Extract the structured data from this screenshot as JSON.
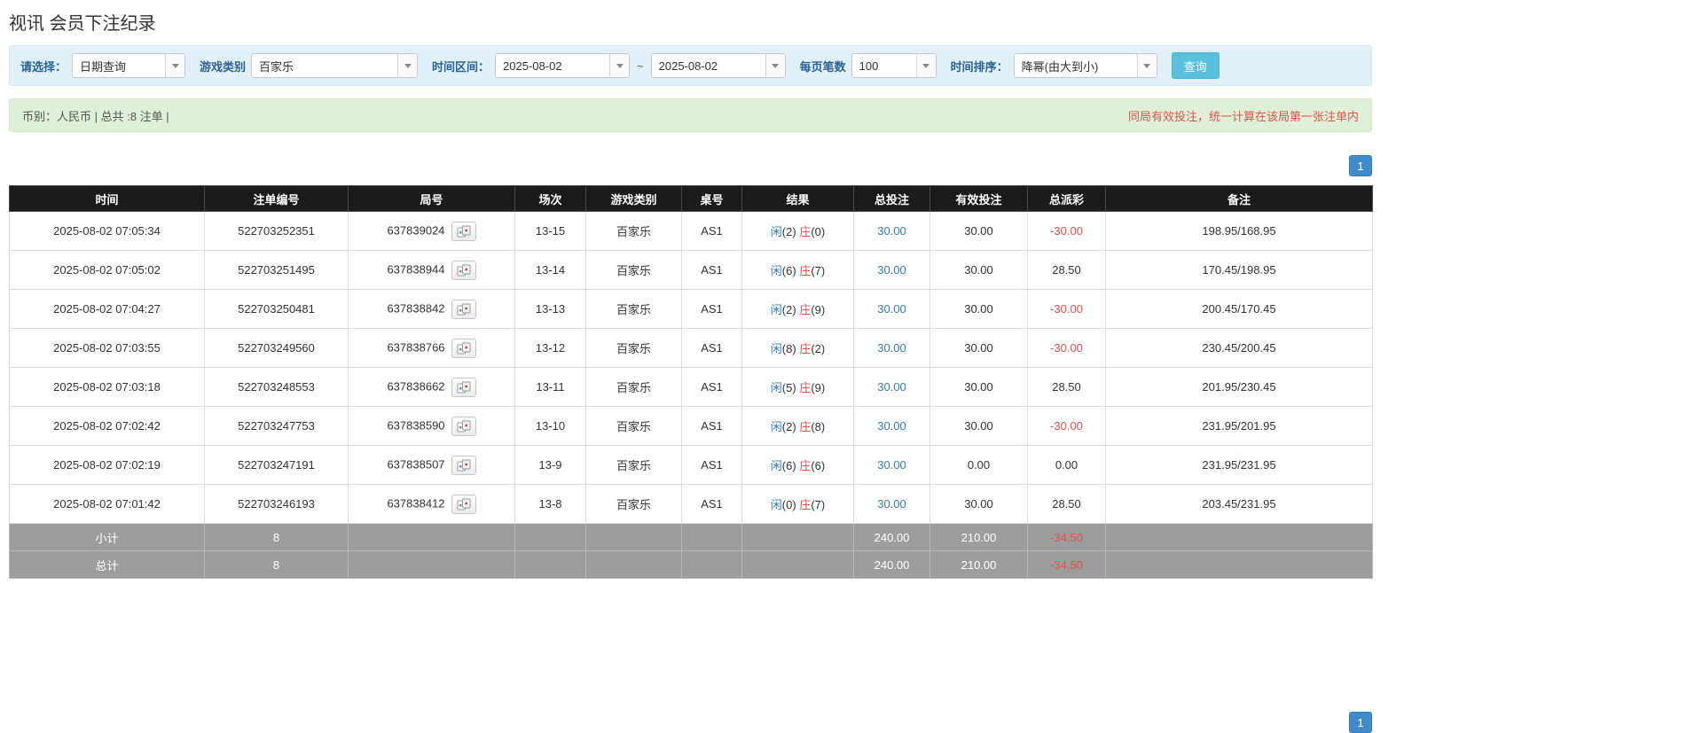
{
  "page": {
    "title": "视讯 会员下注纪录"
  },
  "filters": {
    "select_label": "请选择：",
    "select_value": "日期查询",
    "game_label": "游戏类别",
    "game_value": "百家乐",
    "range_label": "时间区间：",
    "date_from": "2025-08-02",
    "tilde": "~",
    "date_to": "2025-08-02",
    "per_page_label": "每页笔数",
    "per_page_value": "100",
    "sort_label": "时间排序：",
    "sort_value": "降幂(由大到小)",
    "query_button": "查询"
  },
  "summary": {
    "left": "币别：人民币 | 总共 :8 注单 |",
    "right": "同局有效投注，统一计算在该局第一张注单内"
  },
  "pagination": {
    "page": "1"
  },
  "icons": {
    "round_detail": "cards-preview-icon",
    "dropdown": "chevron-down-icon"
  },
  "table": {
    "headers": [
      "时间",
      "注单编号",
      "局号",
      "场次",
      "游戏类别",
      "桌号",
      "结果",
      "总投注",
      "有效投注",
      "总派彩",
      "备注"
    ],
    "rows": [
      {
        "time": "2025-08-02 07:05:34",
        "bet_id": "522703252351",
        "round": "637839024",
        "session": "13-15",
        "game": "百家乐",
        "table_no": "AS1",
        "player": "闲",
        "player_n": "(2)",
        "banker": "庄",
        "banker_n": "(0)",
        "total_bet": "30.00",
        "valid_bet": "30.00",
        "payout": "-30.00",
        "remark": "198.95/168.95"
      },
      {
        "time": "2025-08-02 07:05:02",
        "bet_id": "522703251495",
        "round": "637838944",
        "session": "13-14",
        "game": "百家乐",
        "table_no": "AS1",
        "player": "闲",
        "player_n": "(6)",
        "banker": "庄",
        "banker_n": "(7)",
        "total_bet": "30.00",
        "valid_bet": "30.00",
        "payout": "28.50",
        "remark": "170.45/198.95"
      },
      {
        "time": "2025-08-02 07:04:27",
        "bet_id": "522703250481",
        "round": "637838842",
        "session": "13-13",
        "game": "百家乐",
        "table_no": "AS1",
        "player": "闲",
        "player_n": "(2)",
        "banker": "庄",
        "banker_n": "(9)",
        "total_bet": "30.00",
        "valid_bet": "30.00",
        "payout": "-30.00",
        "remark": "200.45/170.45"
      },
      {
        "time": "2025-08-02 07:03:55",
        "bet_id": "522703249560",
        "round": "637838766",
        "session": "13-12",
        "game": "百家乐",
        "table_no": "AS1",
        "player": "闲",
        "player_n": "(8)",
        "banker": "庄",
        "banker_n": "(2)",
        "total_bet": "30.00",
        "valid_bet": "30.00",
        "payout": "-30.00",
        "remark": "230.45/200.45"
      },
      {
        "time": "2025-08-02 07:03:18",
        "bet_id": "522703248553",
        "round": "637838662",
        "session": "13-11",
        "game": "百家乐",
        "table_no": "AS1",
        "player": "闲",
        "player_n": "(5)",
        "banker": "庄",
        "banker_n": "(9)",
        "total_bet": "30.00",
        "valid_bet": "30.00",
        "payout": "28.50",
        "remark": "201.95/230.45"
      },
      {
        "time": "2025-08-02 07:02:42",
        "bet_id": "522703247753",
        "round": "637838590",
        "session": "13-10",
        "game": "百家乐",
        "table_no": "AS1",
        "player": "闲",
        "player_n": "(2)",
        "banker": "庄",
        "banker_n": "(8)",
        "total_bet": "30.00",
        "valid_bet": "30.00",
        "payout": "-30.00",
        "remark": "231.95/201.95"
      },
      {
        "time": "2025-08-02 07:02:19",
        "bet_id": "522703247191",
        "round": "637838507",
        "session": "13-9",
        "game": "百家乐",
        "table_no": "AS1",
        "player": "闲",
        "player_n": "(6)",
        "banker": "庄",
        "banker_n": "(6)",
        "total_bet": "30.00",
        "valid_bet": "0.00",
        "payout": "0.00",
        "remark": "231.95/231.95"
      },
      {
        "time": "2025-08-02 07:01:42",
        "bet_id": "522703246193",
        "round": "637838412",
        "session": "13-8",
        "game": "百家乐",
        "table_no": "AS1",
        "player": "闲",
        "player_n": "(0)",
        "banker": "庄",
        "banker_n": "(7)",
        "total_bet": "30.00",
        "valid_bet": "30.00",
        "payout": "28.50",
        "remark": "203.45/231.95"
      }
    ],
    "subtotal": {
      "label": "小计",
      "count": "8",
      "total_bet": "240.00",
      "valid_bet": "210.00",
      "payout": "-34.50"
    },
    "total": {
      "label": "总计",
      "count": "8",
      "total_bet": "240.00",
      "valid_bet": "210.00",
      "payout": "-34.50"
    }
  }
}
